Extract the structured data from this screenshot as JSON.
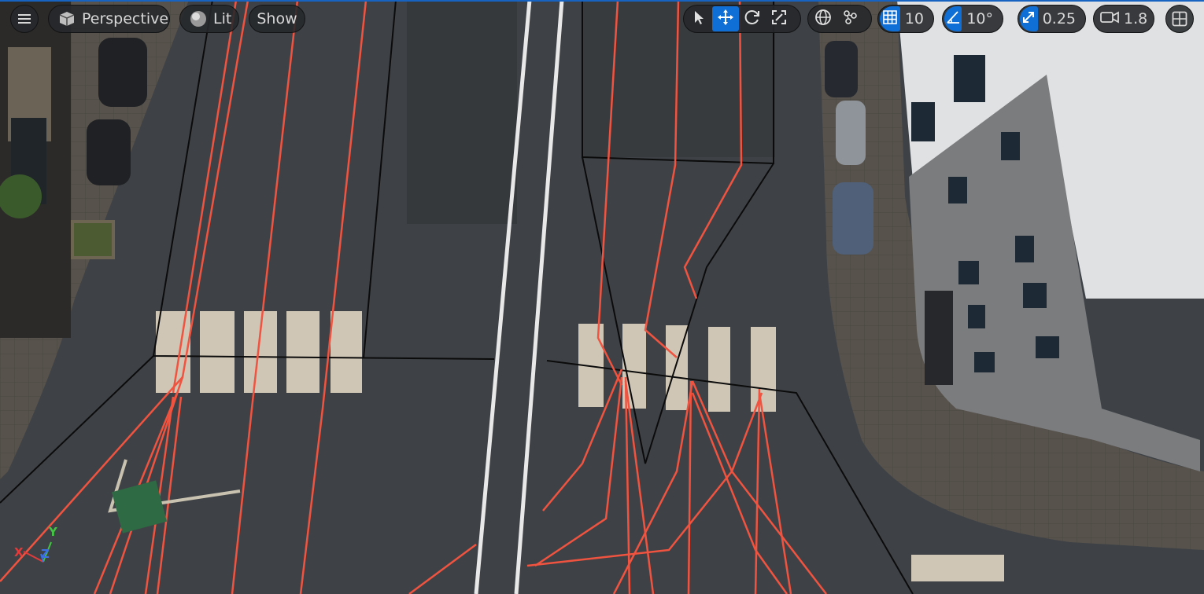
{
  "toolbar": {
    "menu_icon": "hamburger-icon",
    "view_mode": {
      "label": "Perspective",
      "icon": "cube-icon"
    },
    "lighting": {
      "label": "Lit",
      "icon": "sphere-icon"
    },
    "show_label": "Show",
    "transform_tools": [
      "select-icon",
      "move-icon",
      "rotate-icon",
      "scale-icon"
    ],
    "active_tool": "move",
    "coordinate_space_icon": "globe-icon",
    "surface_snap_icon": "surface-snap-icon",
    "grid_snap": {
      "icon": "grid-icon",
      "value": "10"
    },
    "rotation_snap": {
      "icon": "angle-icon",
      "value": "10°"
    },
    "scale_snap": {
      "icon": "scale-snap-icon",
      "value": "0.25"
    },
    "camera_speed": {
      "icon": "camera-icon",
      "value": "1.8"
    },
    "layout_icon": "viewport-layout-icon"
  },
  "colors": {
    "accent": "#0f6fd6",
    "lane_path": "#f0533f",
    "asphalt": "#3f4347",
    "sidewalk": "#5b5650"
  },
  "axis_gizmo": {
    "x_label": "X",
    "y_label": "Y",
    "z_label": "Z"
  }
}
